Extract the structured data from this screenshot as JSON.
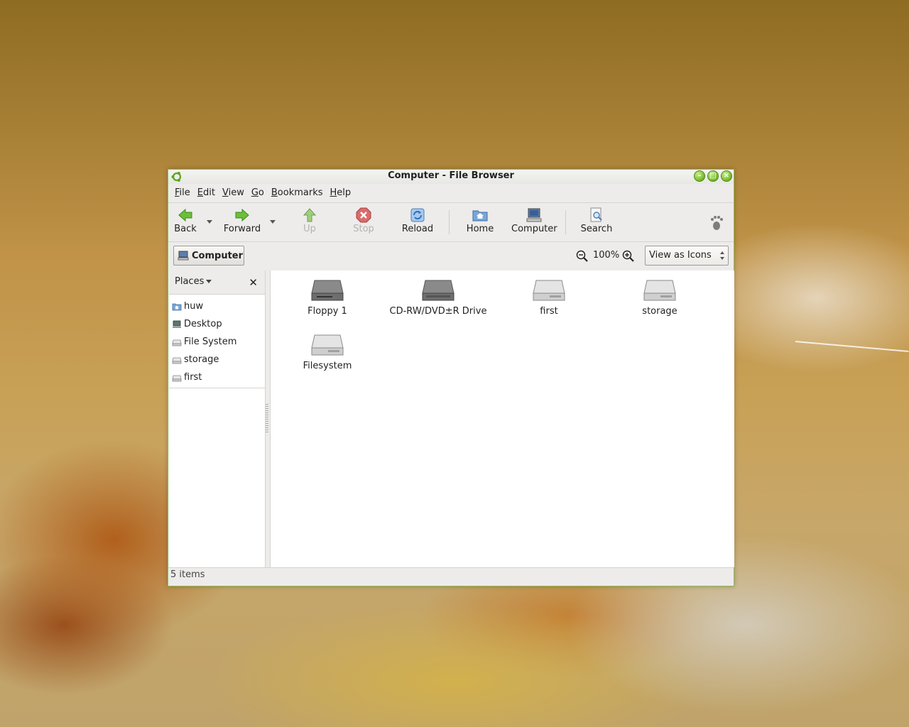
{
  "window": {
    "title": "Computer - File Browser",
    "accent": "#73b82b"
  },
  "menubar": [
    {
      "mnemonic": "F",
      "rest": "ile"
    },
    {
      "mnemonic": "E",
      "rest": "dit"
    },
    {
      "mnemonic": "V",
      "rest": "iew"
    },
    {
      "mnemonic": "G",
      "rest": "o"
    },
    {
      "mnemonic": "B",
      "rest": "ookmarks"
    },
    {
      "mnemonic": "H",
      "rest": "elp"
    }
  ],
  "toolbar": {
    "back": "Back",
    "forward": "Forward",
    "up": "Up",
    "stop": "Stop",
    "reload": "Reload",
    "home": "Home",
    "computer": "Computer",
    "search": "Search"
  },
  "location": {
    "path_button": "Computer",
    "zoom": "100%",
    "view_mode": "View as Icons"
  },
  "sidebar": {
    "header": "Places",
    "items": [
      {
        "label": "huw",
        "icon": "home-folder-icon"
      },
      {
        "label": "Desktop",
        "icon": "desktop-icon"
      },
      {
        "label": "File System",
        "icon": "drive-icon"
      },
      {
        "label": "storage",
        "icon": "drive-icon"
      },
      {
        "label": "first",
        "icon": "drive-icon"
      }
    ]
  },
  "files": [
    {
      "label": "Floppy 1",
      "icon": "floppy-drive-icon"
    },
    {
      "label": "CD-RW/DVD±R Drive",
      "icon": "optical-drive-icon"
    },
    {
      "label": "first",
      "icon": "harddisk-icon"
    },
    {
      "label": "storage",
      "icon": "harddisk-icon"
    },
    {
      "label": "Filesystem",
      "icon": "harddisk-icon"
    }
  ],
  "status": {
    "text": "5 items"
  }
}
